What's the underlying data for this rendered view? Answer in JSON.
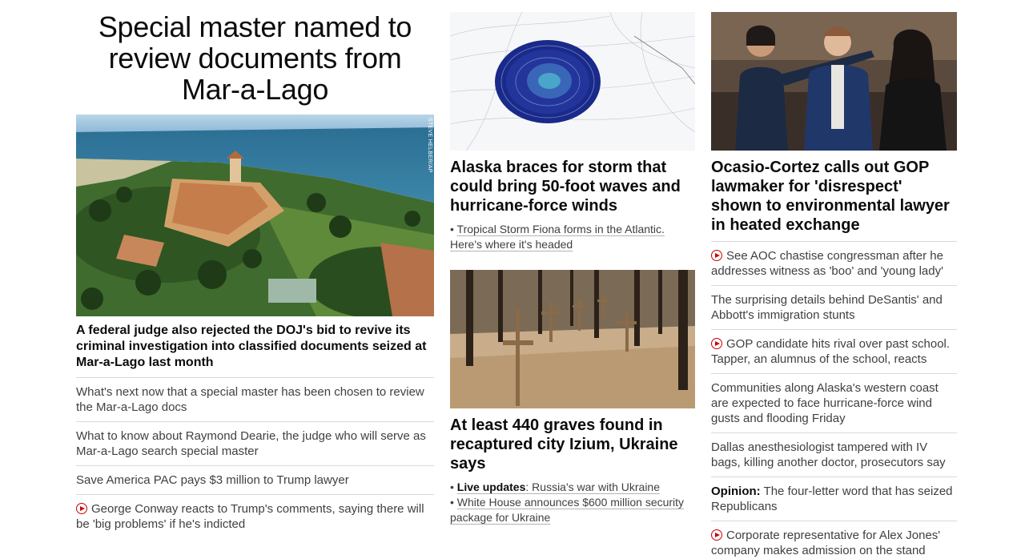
{
  "lead": {
    "title": "Special master named to review documents from Mar-a-Lago",
    "image_credit": "STEVE HELBER/AP",
    "image_alt": "Aerial view of Mar-a-Lago estate by the ocean",
    "headline": "A federal judge also rejected the DOJ's bid to revive its criminal investigation into classified documents seized at Mar-a-Lago last month",
    "stories": [
      {
        "text": "What's next now that a special master has been chosen to review the Mar-a-Lago docs",
        "video": false
      },
      {
        "text": "What to know about Raymond Dearie, the judge who will serve as Mar-a-Lago search special master",
        "video": false
      },
      {
        "text": "Save America PAC pays $3 million to Trump lawyer",
        "video": false
      },
      {
        "text": "George Conway reacts to Trump's comments, saying there will be 'big problems' if he's indicted",
        "video": true
      }
    ]
  },
  "middle": {
    "card1": {
      "image_alt": "Weather map of storm over Alaska",
      "title": "Alaska braces for storm that could bring 50-foot waves and hurricane-force winds",
      "sub_prefix": "•",
      "sub": "Tropical Storm Fiona forms in the Atlantic. Here's where it's headed"
    },
    "card2": {
      "image_alt": "Wooden crosses over graves in a forest",
      "title": "At least 440 graves found in recaptured city Izium, Ukraine says",
      "sub1_prefix": "•",
      "sub1_bold": "Live updates",
      "sub1_text": ": Russia's war with Ukraine",
      "sub2_prefix": "•",
      "sub2": "White House announces $600 million security package for Ukraine"
    }
  },
  "right": {
    "image_alt": "Ocasio-Cortez gesturing toward witnesses at hearing",
    "title": "Ocasio-Cortez calls out GOP lawmaker for 'disrespect' shown to environmental lawyer in heated exchange",
    "stories": [
      {
        "text": "See AOC chastise congressman after he addresses witness as 'boo' and 'young lady'",
        "video": true,
        "prefix": ""
      },
      {
        "text": "The surprising details behind DeSantis' and Abbott's immigration stunts",
        "video": false,
        "prefix": ""
      },
      {
        "text": "GOP candidate hits rival over past school. Tapper, an alumnus of the school, reacts",
        "video": true,
        "prefix": ""
      },
      {
        "text": "Communities along Alaska's western coast are expected to face hurricane-force wind gusts and flooding Friday",
        "video": false,
        "prefix": ""
      },
      {
        "text": "Dallas anesthesiologist tampered with IV bags, killing another doctor, prosecutors say",
        "video": false,
        "prefix": ""
      },
      {
        "text": " The four-letter word that has seized Republicans",
        "video": false,
        "prefix": "Opinion:"
      },
      {
        "text": "Corporate representative for Alex Jones' company makes admission on the stand",
        "video": true,
        "prefix": ""
      }
    ]
  },
  "colors": {
    "accent_red": "#cc0000",
    "divider": "#d9d9d9",
    "text_primary": "#0c0c0c",
    "text_secondary": "#404040"
  }
}
